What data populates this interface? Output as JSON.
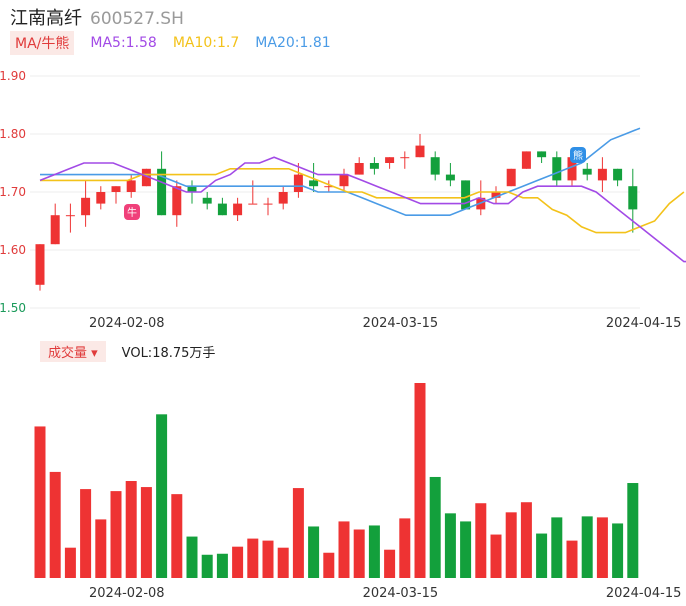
{
  "header": {
    "name": "江南高纤",
    "code": "600527.SH"
  },
  "legend": {
    "indicator_label": "MA/牛熊",
    "ma5": "MA5:1.58",
    "ma10": "MA10:1.7",
    "ma20": "MA20:1.81"
  },
  "vol_legend": {
    "label": "成交量 ▾",
    "value": "VOL:18.75万手"
  },
  "colors": {
    "up": "#ee3333",
    "down": "#13a03c",
    "ma5": "#a24ae6",
    "ma10": "#f3c21a",
    "ma20": "#4a9be6",
    "grid": "#eeeeee",
    "price_tick": "#e03b3b",
    "low_tick": "#1a9a5a"
  },
  "icons": {
    "bull_marker": "bull-icon",
    "bear_marker": "bear-icon"
  },
  "chart_data": [
    {
      "type": "candlestick",
      "ylim": [
        1.5,
        1.9
      ],
      "yticks": [
        "1.90",
        "1.80",
        "1.70",
        "1.60",
        "1.50"
      ],
      "xticks": [
        {
          "index": 4,
          "label": "2024-02-08"
        },
        {
          "index": 22,
          "label": "2024-03-15"
        },
        {
          "index": 38,
          "label": "2024-04-15"
        }
      ],
      "candles": [
        {
          "o": 1.54,
          "c": 1.61,
          "h": 1.61,
          "l": 1.53
        },
        {
          "o": 1.61,
          "c": 1.66,
          "h": 1.68,
          "l": 1.61
        },
        {
          "o": 1.66,
          "c": 1.66,
          "h": 1.68,
          "l": 1.63
        },
        {
          "o": 1.66,
          "c": 1.69,
          "h": 1.72,
          "l": 1.64
        },
        {
          "o": 1.68,
          "c": 1.7,
          "h": 1.71,
          "l": 1.67
        },
        {
          "o": 1.7,
          "c": 1.71,
          "h": 1.71,
          "l": 1.68
        },
        {
          "o": 1.7,
          "c": 1.72,
          "h": 1.73,
          "l": 1.69
        },
        {
          "o": 1.71,
          "c": 1.74,
          "h": 1.74,
          "l": 1.71
        },
        {
          "o": 1.74,
          "c": 1.66,
          "h": 1.77,
          "l": 1.66
        },
        {
          "o": 1.66,
          "c": 1.71,
          "h": 1.72,
          "l": 1.64
        },
        {
          "o": 1.71,
          "c": 1.7,
          "h": 1.72,
          "l": 1.68
        },
        {
          "o": 1.69,
          "c": 1.68,
          "h": 1.7,
          "l": 1.67
        },
        {
          "o": 1.68,
          "c": 1.66,
          "h": 1.69,
          "l": 1.66
        },
        {
          "o": 1.66,
          "c": 1.68,
          "h": 1.69,
          "l": 1.65
        },
        {
          "o": 1.68,
          "c": 1.68,
          "h": 1.72,
          "l": 1.68
        },
        {
          "o": 1.68,
          "c": 1.68,
          "h": 1.69,
          "l": 1.66
        },
        {
          "o": 1.68,
          "c": 1.7,
          "h": 1.71,
          "l": 1.67
        },
        {
          "o": 1.7,
          "c": 1.73,
          "h": 1.75,
          "l": 1.69
        },
        {
          "o": 1.72,
          "c": 1.71,
          "h": 1.75,
          "l": 1.7
        },
        {
          "o": 1.71,
          "c": 1.71,
          "h": 1.72,
          "l": 1.7
        },
        {
          "o": 1.71,
          "c": 1.73,
          "h": 1.74,
          "l": 1.7
        },
        {
          "o": 1.73,
          "c": 1.75,
          "h": 1.76,
          "l": 1.73
        },
        {
          "o": 1.75,
          "c": 1.74,
          "h": 1.76,
          "l": 1.73
        },
        {
          "o": 1.75,
          "c": 1.76,
          "h": 1.76,
          "l": 1.74
        },
        {
          "o": 1.76,
          "c": 1.76,
          "h": 1.77,
          "l": 1.74
        },
        {
          "o": 1.76,
          "c": 1.78,
          "h": 1.8,
          "l": 1.76
        },
        {
          "o": 1.76,
          "c": 1.73,
          "h": 1.77,
          "l": 1.72
        },
        {
          "o": 1.73,
          "c": 1.72,
          "h": 1.75,
          "l": 1.71
        },
        {
          "o": 1.72,
          "c": 1.67,
          "h": 1.72,
          "l": 1.67
        },
        {
          "o": 1.67,
          "c": 1.69,
          "h": 1.72,
          "l": 1.66
        },
        {
          "o": 1.69,
          "c": 1.7,
          "h": 1.71,
          "l": 1.68
        },
        {
          "o": 1.71,
          "c": 1.74,
          "h": 1.74,
          "l": 1.71
        },
        {
          "o": 1.74,
          "c": 1.77,
          "h": 1.77,
          "l": 1.74
        },
        {
          "o": 1.77,
          "c": 1.76,
          "h": 1.77,
          "l": 1.75
        },
        {
          "o": 1.76,
          "c": 1.72,
          "h": 1.77,
          "l": 1.71
        },
        {
          "o": 1.72,
          "c": 1.76,
          "h": 1.76,
          "l": 1.71
        },
        {
          "o": 1.74,
          "c": 1.73,
          "h": 1.75,
          "l": 1.72
        },
        {
          "o": 1.72,
          "c": 1.74,
          "h": 1.76,
          "l": 1.7
        },
        {
          "o": 1.74,
          "c": 1.72,
          "h": 1.74,
          "l": 1.71
        },
        {
          "o": 1.71,
          "c": 1.67,
          "h": 1.74,
          "l": 1.63
        }
      ],
      "ma5": [
        1.72,
        1.73,
        1.74,
        1.75,
        1.75,
        1.75,
        1.74,
        1.73,
        1.72,
        1.71,
        1.7,
        1.7,
        1.72,
        1.73,
        1.75,
        1.75,
        1.76,
        1.75,
        1.74,
        1.73,
        1.73,
        1.73,
        1.72,
        1.71,
        1.7,
        1.69,
        1.68,
        1.68,
        1.68,
        1.68,
        1.69,
        1.68,
        1.68,
        1.7,
        1.71,
        1.71,
        1.71,
        1.71,
        1.7,
        1.68,
        1.66,
        1.64,
        1.62,
        1.6,
        1.58,
        1.58
      ],
      "ma10": [
        1.72,
        1.72,
        1.72,
        1.72,
        1.72,
        1.72,
        1.72,
        1.73,
        1.73,
        1.73,
        1.73,
        1.73,
        1.73,
        1.74,
        1.74,
        1.74,
        1.74,
        1.74,
        1.73,
        1.72,
        1.71,
        1.7,
        1.7,
        1.69,
        1.69,
        1.69,
        1.69,
        1.69,
        1.69,
        1.69,
        1.7,
        1.7,
        1.7,
        1.69,
        1.69,
        1.67,
        1.66,
        1.64,
        1.63,
        1.63,
        1.63,
        1.64,
        1.65,
        1.68,
        1.7
      ],
      "ma20": [
        1.73,
        1.73,
        1.73,
        1.73,
        1.73,
        1.73,
        1.73,
        1.73,
        1.73,
        1.72,
        1.71,
        1.71,
        1.71,
        1.71,
        1.71,
        1.71,
        1.71,
        1.71,
        1.71,
        1.7,
        1.7,
        1.7,
        1.69,
        1.68,
        1.67,
        1.66,
        1.66,
        1.66,
        1.66,
        1.67,
        1.68,
        1.69,
        1.7,
        1.71,
        1.72,
        1.73,
        1.74,
        1.75,
        1.77,
        1.79,
        1.8,
        1.81
      ],
      "markers": [
        {
          "index": 5,
          "kind": "bull",
          "label": "牛"
        },
        {
          "index": 35,
          "kind": "bear",
          "label": "熊"
        }
      ]
    },
    {
      "type": "bar",
      "series_name": "VOL",
      "xticks": [
        {
          "index": 4,
          "label": "2024-02-08"
        },
        {
          "index": 22,
          "label": "2024-03-15"
        },
        {
          "index": 38,
          "label": "2024-04-15"
        }
      ],
      "values": [
        15.0,
        10.5,
        3.0,
        8.8,
        5.8,
        8.6,
        9.6,
        9.0,
        16.2,
        8.3,
        4.1,
        2.3,
        2.4,
        3.1,
        3.9,
        3.7,
        3.0,
        8.9,
        5.1,
        2.5,
        5.6,
        4.8,
        5.2,
        2.8,
        5.9,
        19.3,
        10.0,
        6.4,
        5.6,
        7.4,
        4.3,
        6.5,
        7.5,
        4.4,
        6.0,
        3.7,
        6.1,
        6.0,
        5.4,
        9.4
      ],
      "ylim": [
        0,
        20
      ]
    }
  ]
}
